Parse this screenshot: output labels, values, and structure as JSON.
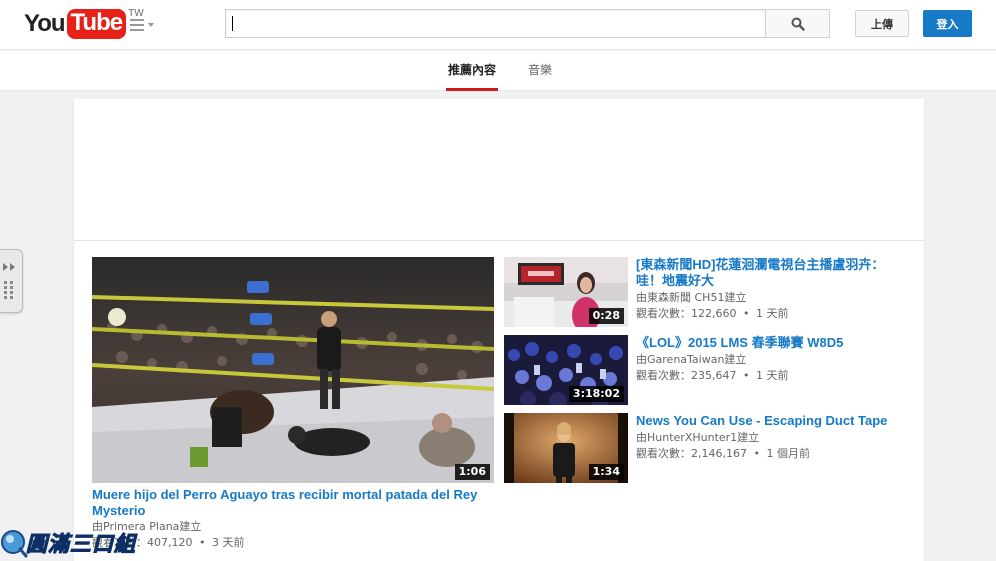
{
  "header": {
    "logo_you": "You",
    "logo_tube": "Tube",
    "region": "TW",
    "search_value": "",
    "upload_label": "上傳",
    "signin_label": "登入"
  },
  "tabs": [
    {
      "label": "推薦內容",
      "active": true
    },
    {
      "label": "音樂",
      "active": false
    }
  ],
  "featured": {
    "title": "Muere hijo del Perro Aguayo tras recibir mortal patada del Rey Mysterio",
    "channel_line": "由Primera Plana建立",
    "views": "觀看次數：407,120",
    "age": "3 天前",
    "duration": "1:06"
  },
  "videos": [
    {
      "title": "[東森新聞HD]花蓮洄瀾電視台主播盧羽卉：哇！地震好大",
      "channel_line": "由東森新聞 CH51建立",
      "views": "觀看次數：122,660",
      "age": "1 天前",
      "duration": "0:28"
    },
    {
      "title": "《LOL》2015 LMS 春季聯賽 W8D5",
      "channel_line": "由GarenaTaiwan建立",
      "views": "觀看次數：235,647",
      "age": "1 天前",
      "duration": "3:18:02"
    },
    {
      "title": "News You Can Use - Escaping Duct Tape",
      "channel_line": "由HunterXHunter1建立",
      "views": "觀看次數：2,146,167",
      "age": "1 個月前",
      "duration": "1:34"
    }
  ],
  "meta_separator": "•",
  "watermark_text": "圓滿三口組",
  "colors": {
    "brand_red": "#e62117",
    "link_blue": "#167ac6",
    "tab_underline": "#cc181e"
  },
  "icons": {
    "search": "search-icon",
    "guide": "hamburger-menu-icon",
    "side": "guide-expand-icon"
  }
}
